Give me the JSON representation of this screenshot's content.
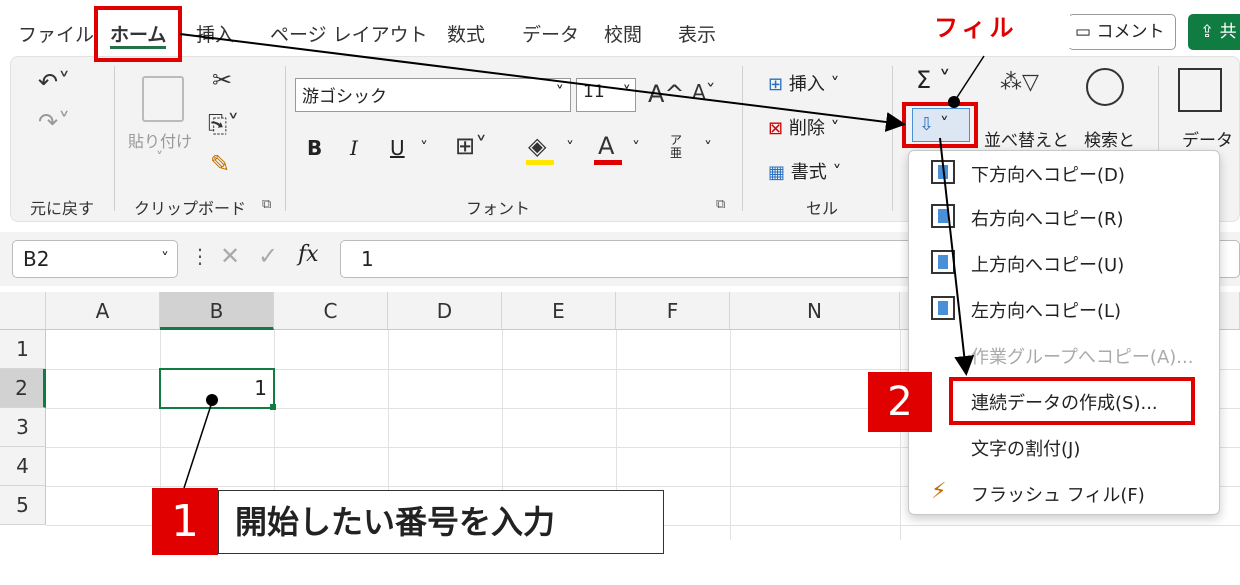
{
  "menu": {
    "tabs": [
      "ファイル",
      "ホーム",
      "挿入",
      "ページ レイアウト",
      "数式",
      "データ",
      "校閲",
      "表示"
    ],
    "comment_label": "コメント",
    "share_label": "共"
  },
  "ribbon": {
    "undo_label": "元に戻す",
    "paste_label": "貼り付け",
    "clipboard_label": "クリップボード",
    "font_name": "游ゴシック",
    "font_size": "11",
    "font_label": "フォント",
    "bold": "B",
    "italic": "I",
    "underline": "U",
    "insert_label": "挿入",
    "delete_label": "削除",
    "format_label": "書式",
    "cell_label": "セル",
    "sort_label": "並べ替えと",
    "find_label": "検索と",
    "data_label": "データ",
    "sigma": "Σ"
  },
  "formula": {
    "name_box": "B2",
    "fx": "fx",
    "value": "1"
  },
  "sheet": {
    "columns": [
      "A",
      "B",
      "C",
      "D",
      "E",
      "F",
      "N"
    ],
    "rows": [
      "1",
      "2",
      "3",
      "4",
      "5"
    ],
    "b2_value": "1"
  },
  "fill_menu": {
    "items": [
      {
        "label": "下方向へコピー(D)",
        "enabled": true
      },
      {
        "label": "右方向へコピー(R)",
        "enabled": true
      },
      {
        "label": "上方向へコピー(U)",
        "enabled": true
      },
      {
        "label": "左方向へコピー(L)",
        "enabled": true
      },
      {
        "label": "作業グループへコピー(A)...",
        "enabled": false
      },
      {
        "label": "連続データの作成(S)...",
        "enabled": true
      },
      {
        "label": "文字の割付(J)",
        "enabled": true
      },
      {
        "label": "フラッシュ フィル(F)",
        "enabled": true
      }
    ]
  },
  "annotations": {
    "fill_title": "フィル",
    "step1_num": "1",
    "step1_text": "開始したい番号を入力",
    "step2_num": "2"
  },
  "colors": {
    "accent_red": "#e00000",
    "excel_green": "#217346",
    "selection_green": "#107c41"
  }
}
